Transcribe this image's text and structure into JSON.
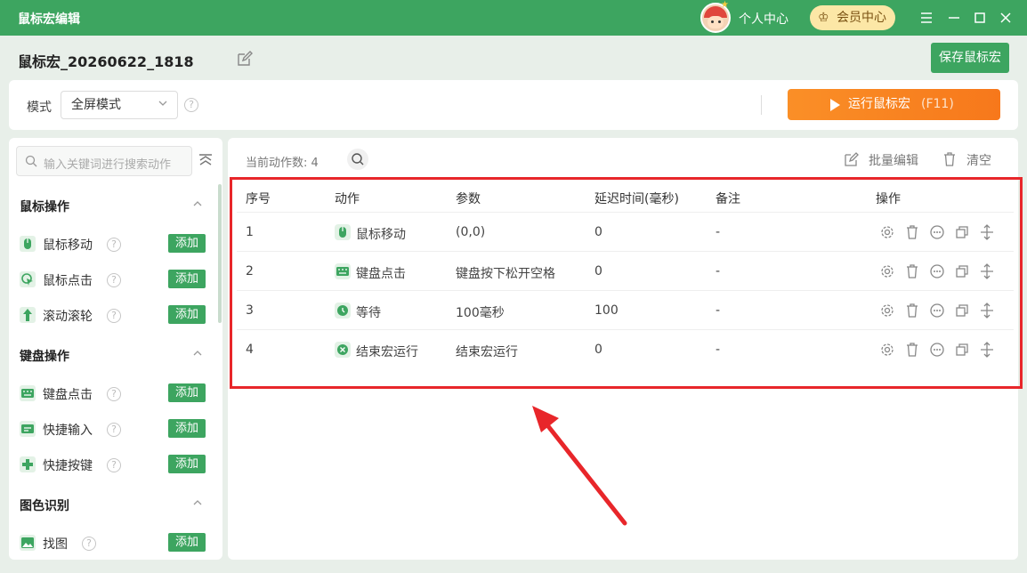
{
  "titlebar": {
    "title": "鼠标宏编辑",
    "user_center": "个人中心",
    "vip_center": "会员中心"
  },
  "header": {
    "macro_name": "鼠标宏_20260622_1818",
    "save_label": "保存鼠标宏"
  },
  "mode": {
    "label": "模式",
    "selected": "全屏模式",
    "run_label": "运行鼠标宏",
    "run_hotkey": "(F11)"
  },
  "sidebar": {
    "search_placeholder": "输入关键词进行搜索动作",
    "add_label": "添加",
    "groups": [
      {
        "title": "鼠标操作",
        "items": [
          "鼠标移动",
          "鼠标点击",
          "滚动滚轮"
        ]
      },
      {
        "title": "键盘操作",
        "items": [
          "键盘点击",
          "快捷输入",
          "快捷按键"
        ]
      },
      {
        "title": "图色识别",
        "items": [
          "找图"
        ]
      }
    ]
  },
  "main": {
    "count_label": "当前动作数:",
    "count_value": "4",
    "bulk_edit": "批量编辑",
    "clear": "清空",
    "columns": [
      "序号",
      "动作",
      "参数",
      "延迟时间(毫秒)",
      "备注",
      "操作"
    ],
    "rows": [
      {
        "index": "1",
        "action": "鼠标移动",
        "param": "(0,0)",
        "delay": "0",
        "note": "-",
        "icon": "mouse-icon"
      },
      {
        "index": "2",
        "action": "键盘点击",
        "param": "键盘按下松开空格",
        "delay": "0",
        "note": "-",
        "icon": "keyboard-icon"
      },
      {
        "index": "3",
        "action": "等待",
        "param": "100毫秒",
        "delay": "100",
        "note": "-",
        "icon": "wait-icon"
      },
      {
        "index": "4",
        "action": "结束宏运行",
        "param": "结束宏运行",
        "delay": "0",
        "note": "-",
        "icon": "stop-icon"
      }
    ]
  },
  "colors": {
    "brand_green": "#3da560",
    "run_orange": "#f7781b",
    "highlight_red": "#e8262a"
  }
}
